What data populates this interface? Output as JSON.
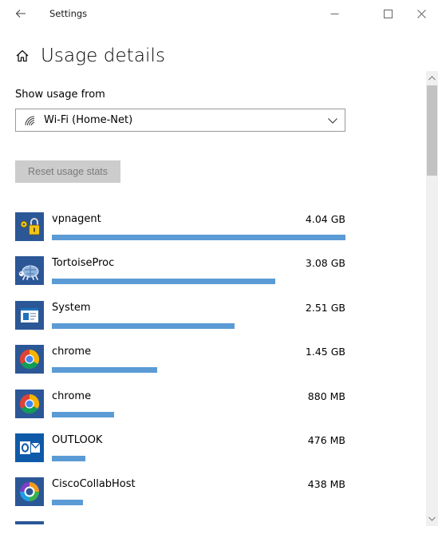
{
  "window": {
    "title": "Settings"
  },
  "page": {
    "title": "Usage details"
  },
  "usage_source": {
    "label": "Show usage from",
    "selected": "Wi-Fi (Home-Net)"
  },
  "reset_button": {
    "label": "Reset usage stats"
  },
  "apps": [
    {
      "name": "vpnagent",
      "usage": "4.04 GB",
      "icon": "vpnagent-lock-icon",
      "fraction": 1.0
    },
    {
      "name": "TortoiseProc",
      "usage": "3.08 GB",
      "icon": "tortoise-icon",
      "fraction": 0.762
    },
    {
      "name": "System",
      "usage": "2.51 GB",
      "icon": "system-window-icon",
      "fraction": 0.621
    },
    {
      "name": "chrome",
      "usage": "1.45 GB",
      "icon": "chrome-icon",
      "fraction": 0.359
    },
    {
      "name": "chrome",
      "usage": "880 MB",
      "icon": "chrome-icon",
      "fraction": 0.213
    },
    {
      "name": "OUTLOOK",
      "usage": "476 MB",
      "icon": "outlook-icon",
      "fraction": 0.115
    },
    {
      "name": "CiscoCollabHost",
      "usage": "438 MB",
      "icon": "cisco-collab-icon",
      "fraction": 0.106
    }
  ],
  "colors": {
    "bar": "#5b9bd5",
    "icon_tile": "#2b5797",
    "reset_bg": "#cccccc",
    "reset_text": "#7a7a7a"
  }
}
